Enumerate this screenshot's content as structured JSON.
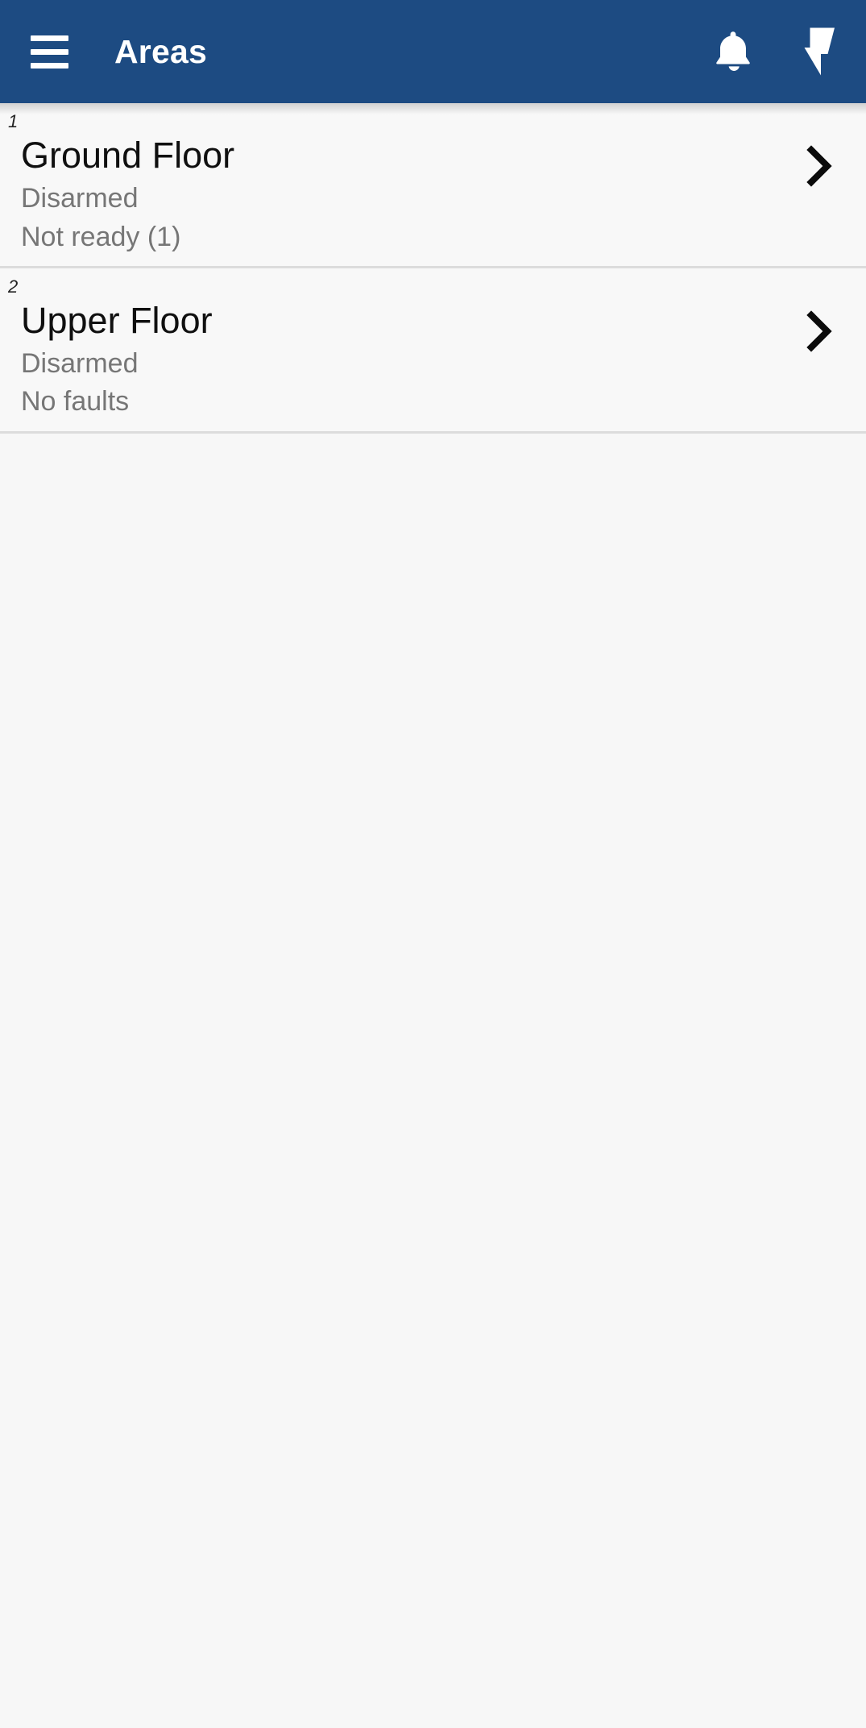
{
  "appbar": {
    "title": "Areas",
    "menu_icon": "hamburger-menu-icon",
    "notifications_icon": "bell-icon",
    "panic_icon": "lightning-bolt-icon",
    "background_color": "#1d4b82",
    "foreground_color": "#ffffff"
  },
  "areas": [
    {
      "index": "1",
      "name": "Ground Floor",
      "status": "Disarmed",
      "faults": "Not ready (1)",
      "chevron_icon": "chevron-right-icon"
    },
    {
      "index": "2",
      "name": "Upper Floor",
      "status": "Disarmed",
      "faults": "No faults",
      "chevron_icon": "chevron-right-icon"
    }
  ],
  "colors": {
    "page_background": "#f7f7f7",
    "row_background": "#f8f8f8",
    "divider": "#dcdcdc",
    "primary_text": "#101010",
    "secondary_text": "#767676"
  }
}
